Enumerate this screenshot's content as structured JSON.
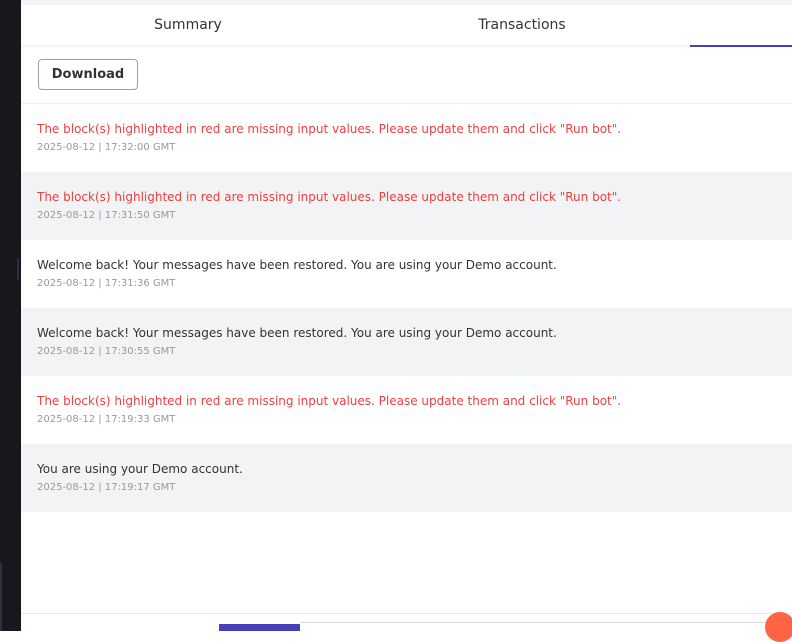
{
  "tabs": [
    {
      "label": "Summary"
    },
    {
      "label": "Transactions"
    },
    {
      "label": ""
    }
  ],
  "toolbar": {
    "download_label": "Download"
  },
  "journal": [
    {
      "message": "The block(s) highlighted in red are missing input values. Please update them and click \"Run bot\".",
      "timestamp": "2025-08-12 | 17:32:00 GMT",
      "type": "error"
    },
    {
      "message": "The block(s) highlighted in red are missing input values. Please update them and click \"Run bot\".",
      "timestamp": "2025-08-12 | 17:31:50 GMT",
      "type": "error"
    },
    {
      "message": "Welcome back! Your messages have been restored. You are using your Demo account.",
      "timestamp": "2025-08-12 | 17:31:36 GMT",
      "type": "info"
    },
    {
      "message": "Welcome back! Your messages have been restored. You are using your Demo account.",
      "timestamp": "2025-08-12 | 17:30:55 GMT",
      "type": "info"
    },
    {
      "message": "The block(s) highlighted in red are missing input values. Please update them and click \"Run bot\".",
      "timestamp": "2025-08-12 | 17:19:33 GMT",
      "type": "error"
    },
    {
      "message": "You are using your Demo account.",
      "timestamp": "2025-08-12 | 17:19:17 GMT",
      "type": "info"
    }
  ],
  "colors": {
    "accent": "#4b3fb8",
    "error_text": "#ec3f3f",
    "alt_row": "#f2f3f4",
    "fab": "#ff6444"
  }
}
